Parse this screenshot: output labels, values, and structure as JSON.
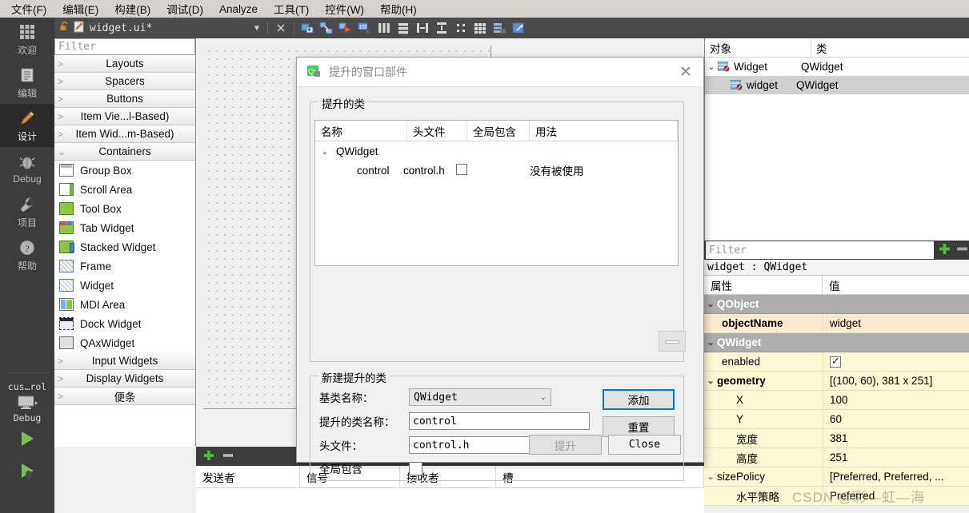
{
  "menubar": {
    "items": [
      {
        "label": "文件(F)"
      },
      {
        "label": "编辑(E)"
      },
      {
        "label": "构建(B)"
      },
      {
        "label": "调试(D)"
      },
      {
        "label": "Analyze"
      },
      {
        "label": "工具(T)"
      },
      {
        "label": "控件(W)"
      },
      {
        "label": "帮助(H)"
      }
    ]
  },
  "modebar": {
    "items": [
      {
        "label": "欢迎",
        "icon": "grid-icon",
        "active": false
      },
      {
        "label": "编辑",
        "icon": "document-icon",
        "active": false
      },
      {
        "label": "设计",
        "icon": "pencil-icon",
        "active": true
      },
      {
        "label": "Debug",
        "icon": "bug-icon",
        "active": false
      },
      {
        "label": "项目",
        "icon": "wrench-icon",
        "active": false
      },
      {
        "label": "帮助",
        "icon": "question-icon",
        "active": false
      }
    ],
    "kit_label": "cus…rol",
    "kit_sub": "Debug",
    "run_icon": "run-triangle-icon",
    "debug_run_icon": "debug-run-icon"
  },
  "toolbar": {
    "filename": "widget.ui*",
    "lock_icon": "unlocked-icon",
    "file_icon": "ui-file-icon",
    "dropdown_icon": "chevron-down-icon",
    "close_icon": "close-x-icon",
    "icons": [
      "edit-widgets-icon",
      "edit-signals-slots-icon",
      "edit-buddies-icon",
      "edit-tab-order-icon",
      "layout-horizontal-icon",
      "layout-vertical-icon",
      "layout-splitter-h-icon",
      "layout-splitter-v-icon",
      "layout-form-icon",
      "layout-grid-icon",
      "break-layout-icon",
      "adjust-size-icon"
    ]
  },
  "widgetbox": {
    "filter_placeholder": "Filter",
    "categories": [
      {
        "label": "Layouts",
        "expanded": false
      },
      {
        "label": "Spacers",
        "expanded": false
      },
      {
        "label": "Buttons",
        "expanded": false
      },
      {
        "label": "Item Vie...l-Based)",
        "expanded": false
      },
      {
        "label": "Item Wid...m-Based)",
        "expanded": false
      },
      {
        "label": "Containers",
        "expanded": true
      }
    ],
    "items": [
      {
        "label": "Group Box",
        "icon": "group-box-icon"
      },
      {
        "label": "Scroll Area",
        "icon": "scroll-area-icon"
      },
      {
        "label": "Tool Box",
        "icon": "tool-box-icon"
      },
      {
        "label": "Tab Widget",
        "icon": "tab-widget-icon"
      },
      {
        "label": "Stacked Widget",
        "icon": "stacked-widget-icon"
      },
      {
        "label": "Frame",
        "icon": "frame-icon"
      },
      {
        "label": "Widget",
        "icon": "widget-icon"
      },
      {
        "label": "MDI Area",
        "icon": "mdi-area-icon"
      },
      {
        "label": "Dock Widget",
        "icon": "dock-widget-icon"
      },
      {
        "label": "QAxWidget",
        "icon": "qax-widget-icon"
      }
    ],
    "categories_tail": [
      {
        "label": "Input Widgets",
        "expanded": false
      },
      {
        "label": "Display Widgets",
        "expanded": false
      },
      {
        "label": "便条",
        "expanded": false
      }
    ]
  },
  "dialog": {
    "title": "提升的窗口部件",
    "title_icon": "qt-designer-icon",
    "close_icon": "close-x-icon",
    "group_promoted": "提升的类",
    "table": {
      "headers": [
        "名称",
        "头文件",
        "全局包含",
        "用法"
      ],
      "rows": [
        {
          "name": "QWidget",
          "header": "",
          "global": null,
          "usage": "",
          "is_parent": true
        },
        {
          "name": "control",
          "header": "control.h",
          "global": false,
          "usage": "没有被使用",
          "is_parent": false
        }
      ]
    },
    "minus_button_icon": "minus-icon",
    "group_new": "新建提升的类",
    "form": {
      "base_class_label": "基类名称：",
      "base_class_value": "QWidget",
      "promoted_name_label": "提升的类名称：",
      "promoted_name_value": "control",
      "header_label": "头文件：",
      "header_value": "control.h",
      "global_include_label": "全局包含",
      "global_include_checked": false
    },
    "add_button": "添加",
    "reset_button": "重置",
    "promote_button": "提升",
    "close_button": "Close"
  },
  "object_inspector": {
    "headers": [
      "对象",
      "类"
    ],
    "rows": [
      {
        "object": "Widget",
        "class": "QWidget",
        "indent": 0,
        "expanded": true,
        "selected": false,
        "icon": "widget-tree-icon"
      },
      {
        "object": "widget",
        "class": "QWidget",
        "indent": 1,
        "expanded": null,
        "selected": true,
        "icon": "widget-tree-icon"
      }
    ]
  },
  "property_editor": {
    "filter_placeholder": "Filter",
    "add_icon": "plus-icon",
    "remove_icon": "minus-icon",
    "object_line": "widget : QWidget",
    "headers": [
      "属性",
      "值"
    ],
    "rows": [
      {
        "name": "QObject",
        "value": "",
        "type": "group",
        "indent": 0
      },
      {
        "name": "objectName",
        "value": "widget",
        "type": "prop-bold",
        "indent": 1
      },
      {
        "name": "QWidget",
        "value": "",
        "type": "group",
        "indent": 0
      },
      {
        "name": "enabled",
        "value": "",
        "type": "checkbox",
        "checked": true,
        "indent": 1
      },
      {
        "name": "geometry",
        "value": "[(100, 60), 381 x 251]",
        "type": "prop-bold-expand",
        "indent": 0
      },
      {
        "name": "X",
        "value": "100",
        "type": "prop",
        "indent": 2
      },
      {
        "name": "Y",
        "value": "60",
        "type": "prop",
        "indent": 2
      },
      {
        "name": "宽度",
        "value": "381",
        "type": "prop",
        "indent": 2
      },
      {
        "name": "高度",
        "value": "251",
        "type": "prop",
        "indent": 2
      },
      {
        "name": "sizePolicy",
        "value": "[Preferred, Preferred, ...",
        "type": "prop-expand",
        "indent": 0
      },
      {
        "name": "水平策略",
        "value": "Preferred",
        "type": "prop",
        "indent": 2
      }
    ]
  },
  "signal_slot_editor": {
    "add_icon": "plus-icon",
    "remove_icon": "minus-icon",
    "headers": [
      "发送者",
      "信号",
      "接收者",
      "槽"
    ]
  },
  "watermark": "CSDN @彩—虹—海",
  "colors": {
    "accent_blue": "#0078d7",
    "dark_panel": "#3c3c3c",
    "mode_active": "#2b2b2b",
    "prop_group": "#adadad",
    "prop_yellow": "#fbf8d2",
    "prop_peach": "#fde9d2",
    "handle_blue": "#0b1f8f",
    "green": "#3fb13f"
  }
}
